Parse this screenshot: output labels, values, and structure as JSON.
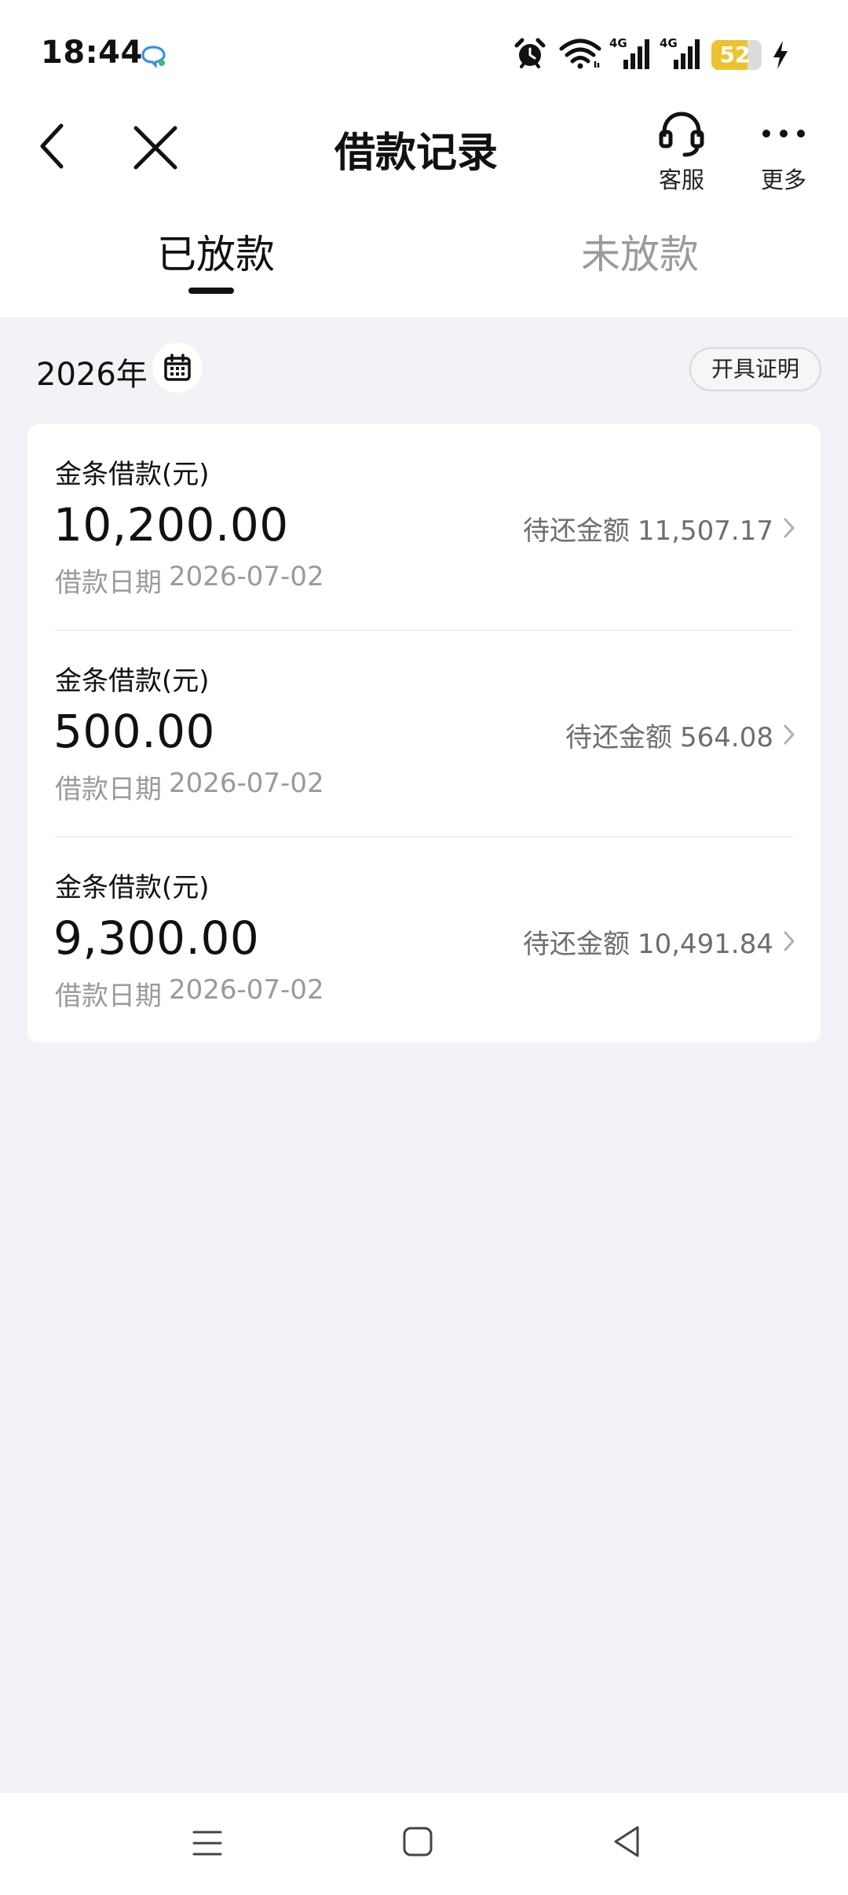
{
  "status_bar": {
    "time": "18:44",
    "battery_level": "52",
    "icons": [
      "chat-bubble-icon",
      "alarm-icon",
      "wifi-icon",
      "signal-4g-icon",
      "signal-4g-icon",
      "battery-icon",
      "charging-bolt-icon"
    ],
    "battery_color": "#ecc32e"
  },
  "header": {
    "title": "借款记录",
    "service_label": "客服",
    "more_label": "更多",
    "icons": [
      "back-arrow-icon",
      "close-icon",
      "headset-icon",
      "more-dots-icon"
    ]
  },
  "tabs": [
    {
      "label": "已放款",
      "active": true
    },
    {
      "label": "未放款",
      "active": false
    }
  ],
  "filter": {
    "year": "2026年",
    "certificate_label": "开具证明",
    "calendar_icon": "calendar-icon"
  },
  "loans": [
    {
      "type": "金条借款(元)",
      "amount": "10,200.00",
      "remaining_label": "待还金额",
      "remaining": "11,507.17",
      "date_label": "借款日期",
      "date": "2026-07-02"
    },
    {
      "type": "金条借款(元)",
      "amount": "500.00",
      "remaining_label": "待还金额",
      "remaining": "564.08",
      "date_label": "借款日期",
      "date": "2026-07-02"
    },
    {
      "type": "金条借款(元)",
      "amount": "9,300.00",
      "remaining_label": "待还金额",
      "remaining": "10,491.84",
      "date_label": "借款日期",
      "date": "2026-07-02"
    }
  ],
  "system_nav": {
    "icons": [
      "menu-icon",
      "home-square-icon",
      "back-triangle-icon"
    ]
  },
  "colors": {
    "page_background": "#f2f2f7",
    "card_background": "#ffffff",
    "active_tab": "#111111",
    "inactive_tab": "#9b9b9b",
    "secondary_text": "#9a9a9a"
  }
}
